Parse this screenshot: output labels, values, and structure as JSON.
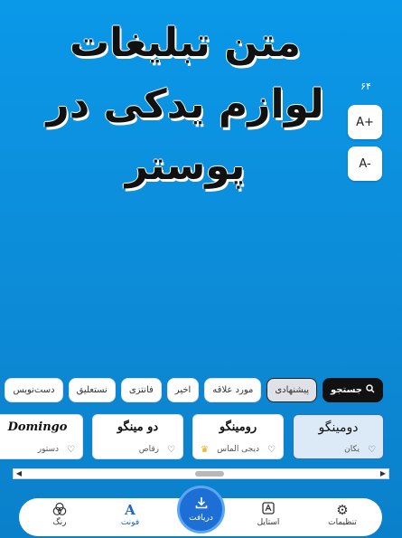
{
  "poster": {
    "line1": "متن تبلیغات",
    "line2": "لوازم یدکی در",
    "line3": "پوستر"
  },
  "font_size": {
    "value": "۶۴",
    "increase_label": "A+",
    "decrease_label": "A-"
  },
  "chips": {
    "search": "جستجو",
    "items": [
      "پیشنهادی",
      "مورد علاقه",
      "اخیر",
      "فانتزی",
      "نستعلیق",
      "دست‌نویس"
    ]
  },
  "font_cards": [
    {
      "sample": "دومینگو",
      "name": "یکان"
    },
    {
      "sample": "رومینگو",
      "name": "دیجی الماس"
    },
    {
      "sample": "دو مینگو",
      "name": "رقاص"
    },
    {
      "sample": "Domingo",
      "name": "دستور"
    }
  ],
  "bottom_nav": {
    "settings": "تنظیمات",
    "style": "استایل",
    "download": "دریافت",
    "font": "فونت",
    "color": "رنگ"
  },
  "colors": {
    "background": "#0a98e8",
    "accent": "#1d6fd6",
    "selected_card": "#dce9f7"
  }
}
